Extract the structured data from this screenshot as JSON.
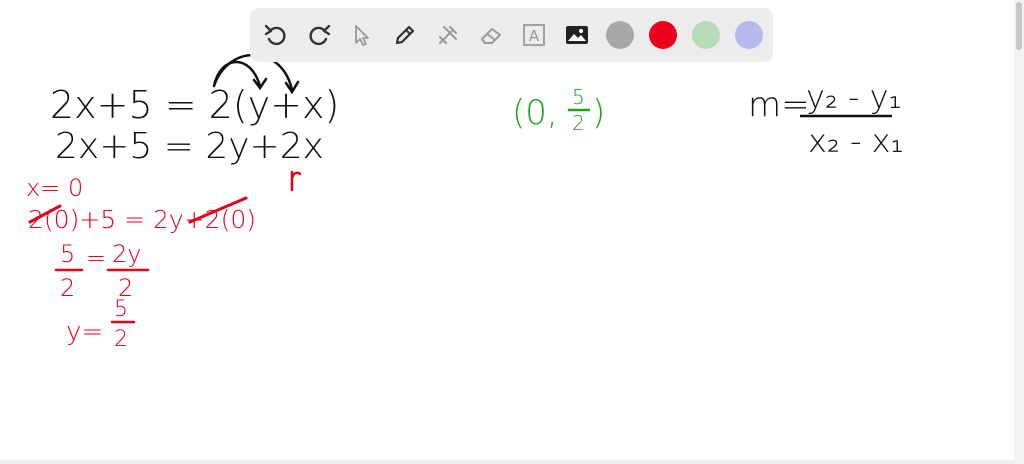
{
  "toolbar": {
    "tools": [
      {
        "name": "undo-icon"
      },
      {
        "name": "redo-icon"
      },
      {
        "name": "select-arrow-icon"
      },
      {
        "name": "pen-icon"
      },
      {
        "name": "tools-icon"
      },
      {
        "name": "eraser-icon"
      },
      {
        "name": "text-icon",
        "label": "A"
      },
      {
        "name": "image-icon"
      }
    ],
    "colors": [
      "#a8a8a8",
      "#e8001c",
      "#b6dcb6",
      "#b4b8ec"
    ]
  },
  "board": {
    "ink_black": "#111111",
    "ink_red": "#e3001b",
    "ink_green": "#22a022",
    "line1": "2x+5 = 2(y+x)",
    "line2": "2x+5 = 2y+2x",
    "red1": "x= 0",
    "red2": "2(0)+5 = 2y+2(0)",
    "red3_num_left": "5",
    "red3_eq": "=",
    "red3_num_right": "2y",
    "red3_den_left": "2",
    "red3_den_right": "2",
    "red4_y": "y=",
    "red4_num": "5",
    "red4_den": "2",
    "point_open": "(0,",
    "point_num": "5",
    "point_den": "2",
    "point_close": ")",
    "slope_m": "m=",
    "slope_num": "y₂ - y₁",
    "slope_den": "x₂ - x₁"
  }
}
